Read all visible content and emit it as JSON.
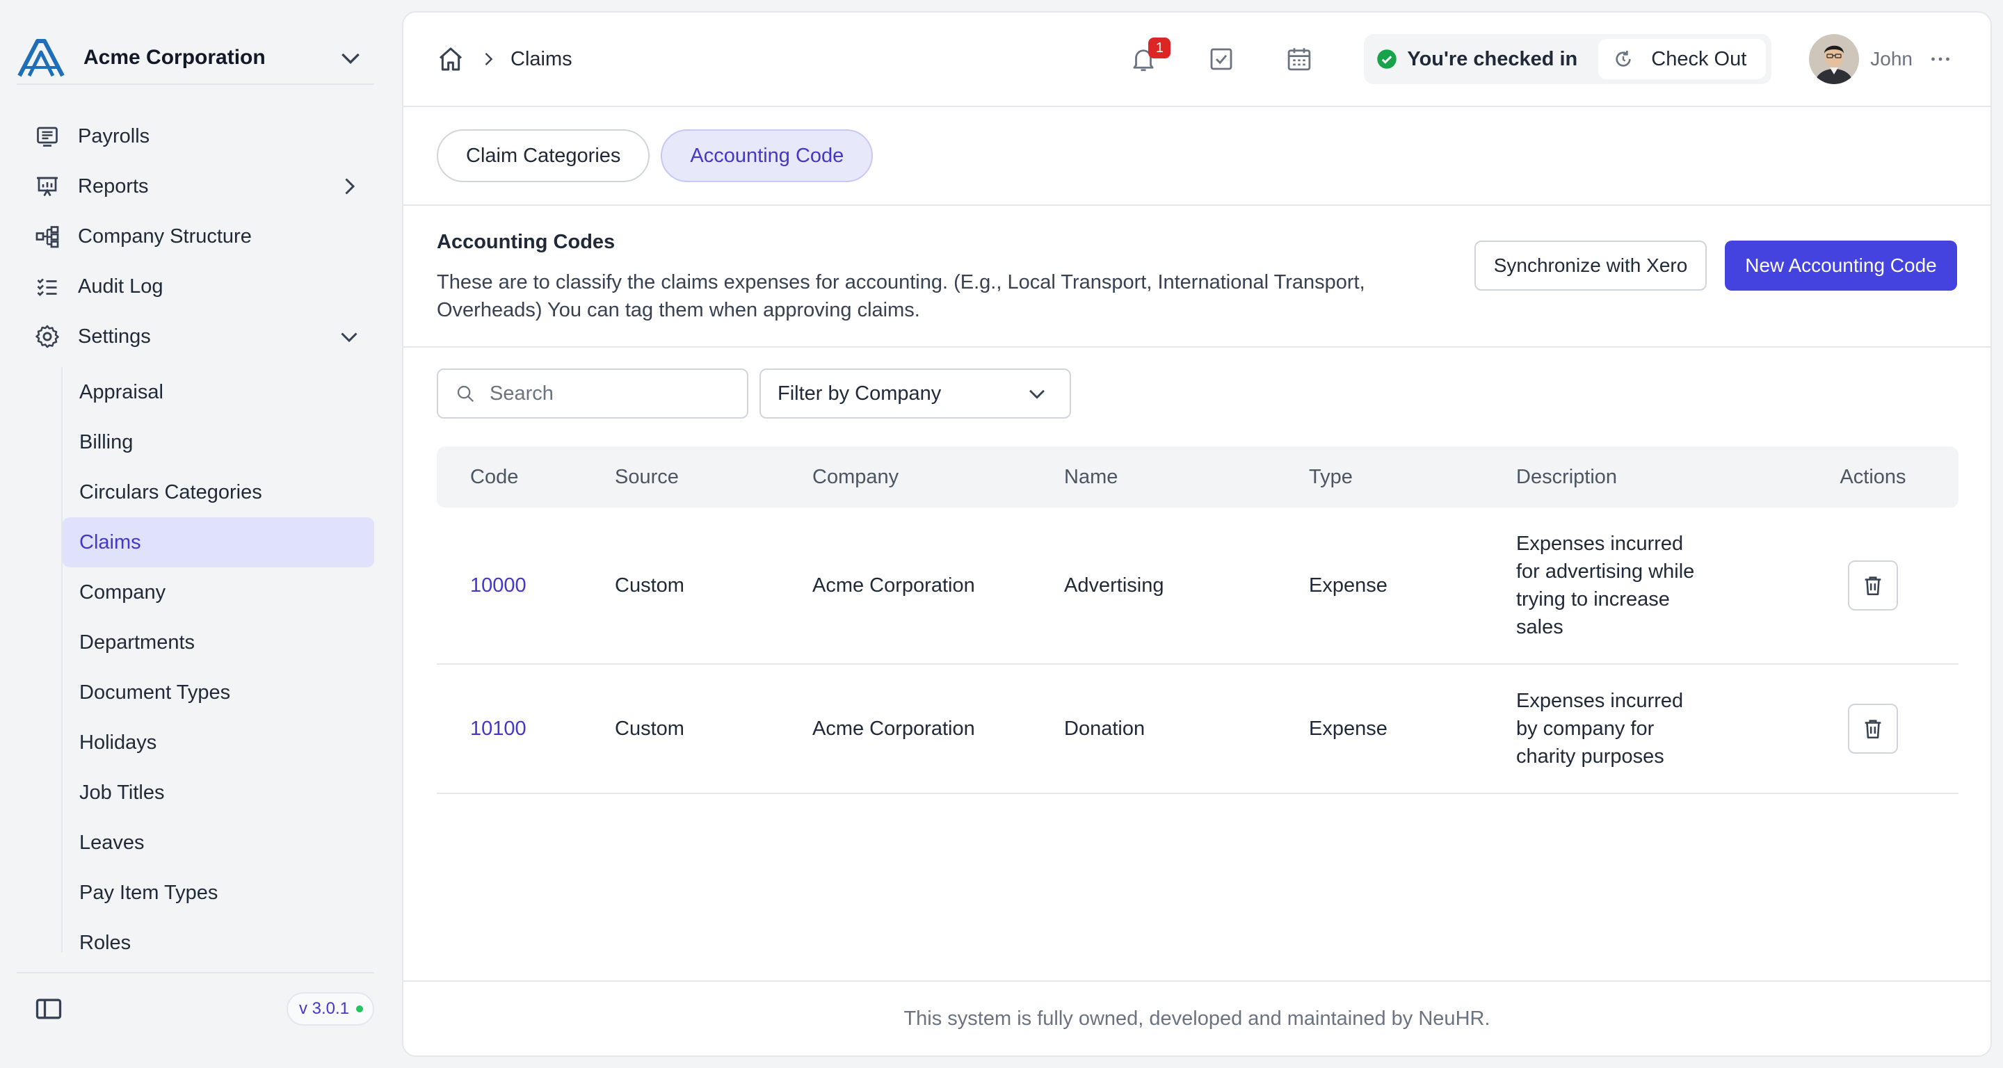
{
  "brand": {
    "name": "Acme Corporation",
    "logo_icon": "acme-logo-icon"
  },
  "sidebar": {
    "items": [
      {
        "label": "Payrolls",
        "icon": "payroll-icon"
      },
      {
        "label": "Reports",
        "icon": "presentation-chart-icon"
      },
      {
        "label": "Company Structure",
        "icon": "hierarchy-icon"
      },
      {
        "label": "Audit Log",
        "icon": "checklist-icon"
      },
      {
        "label": "Settings",
        "icon": "gear-icon"
      }
    ],
    "settings_children": [
      {
        "label": "Appraisal"
      },
      {
        "label": "Billing"
      },
      {
        "label": "Circulars Categories"
      },
      {
        "label": "Claims",
        "active": true
      },
      {
        "label": "Company"
      },
      {
        "label": "Departments"
      },
      {
        "label": "Document Types"
      },
      {
        "label": "Holidays"
      },
      {
        "label": "Job Titles"
      },
      {
        "label": "Leaves"
      },
      {
        "label": "Pay Item Types"
      },
      {
        "label": "Roles"
      }
    ],
    "version": "v 3.0.1"
  },
  "header": {
    "breadcrumb": {
      "current": "Claims"
    },
    "notifications_count": "1",
    "checkin_status": "You're checked in",
    "checkout_label": "Check Out",
    "user_name": "John"
  },
  "tabs": [
    {
      "label": "Claim Categories",
      "active": false
    },
    {
      "label": "Accounting Code",
      "active": true
    }
  ],
  "section": {
    "title": "Accounting Codes",
    "description": "These are to classify the claims expenses for accounting. (E.g., Local Transport, International Transport, Overheads) You can tag them when approving claims.",
    "sync_button": "Synchronize with Xero",
    "new_button": "New Accounting Code"
  },
  "filters": {
    "search_placeholder": "Search",
    "company_filter": "Filter by Company"
  },
  "table": {
    "headers": [
      "Code",
      "Source",
      "Company",
      "Name",
      "Type",
      "Description",
      "Actions"
    ],
    "rows": [
      {
        "code": "10000",
        "source": "Custom",
        "company": "Acme Corporation",
        "name": "Advertising",
        "type": "Expense",
        "description": "Expenses incurred for advertising while trying to increase sales"
      },
      {
        "code": "10100",
        "source": "Custom",
        "company": "Acme Corporation",
        "name": "Donation",
        "type": "Expense",
        "description": "Expenses incurred by company for charity purposes"
      }
    ]
  },
  "footer": {
    "text": "This system is fully owned, developed and maintained by NeuHR."
  },
  "colors": {
    "accent": "#4443e0",
    "active_bg": "#e0e2fb",
    "badge": "#dc2626",
    "online": "#22c55e"
  }
}
